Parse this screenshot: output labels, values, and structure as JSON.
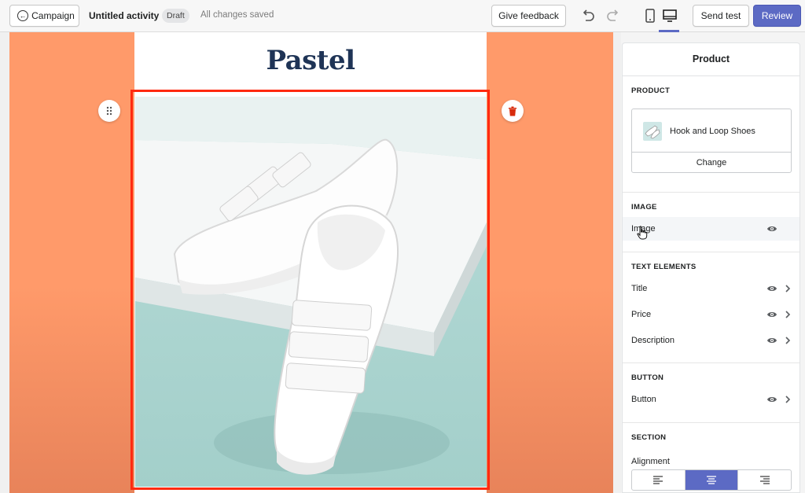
{
  "topbar": {
    "back_label": "Campaign",
    "activity_title": "Untitled activity",
    "status_badge": "Draft",
    "save_status": "All changes saved",
    "feedback_label": "Give feedback",
    "send_test_label": "Send test",
    "review_label": "Review",
    "accent_color": "#5c6ac4"
  },
  "canvas": {
    "brand_name": "Pastel",
    "background_color": "#ff9a6a",
    "selection_color": "#ff2a10"
  },
  "panel": {
    "title": "Product",
    "product_section": "PRODUCT",
    "product_name": "Hook and Loop Shoes",
    "change_label": "Change",
    "image_section": "IMAGE",
    "image_row": "Image",
    "text_section": "TEXT ELEMENTS",
    "text_rows": [
      "Title",
      "Price",
      "Description"
    ],
    "button_section": "BUTTON",
    "button_row": "Button",
    "section_section": "SECTION",
    "alignment_label": "Alignment",
    "alignment_options": [
      "align-left-icon",
      "align-center-icon",
      "align-right-icon"
    ],
    "alignment_selected": "center"
  }
}
